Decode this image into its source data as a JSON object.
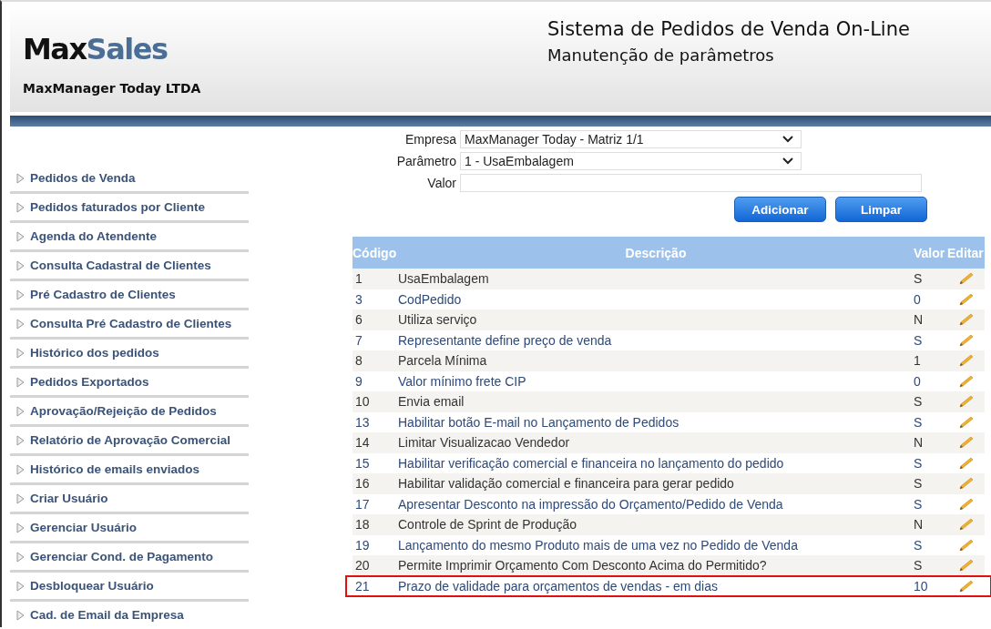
{
  "header": {
    "logo": {
      "part_1": "Max",
      "part_2": "Sales"
    },
    "company": "MaxManager Today LTDA",
    "title": "Sistema de Pedidos de Venda On-Line",
    "subtitle": "Manutenção de parâmetros"
  },
  "sidebar": {
    "items": [
      {
        "label": "Pedidos de Venda"
      },
      {
        "label": "Pedidos faturados por Cliente"
      },
      {
        "label": "Agenda do Atendente"
      },
      {
        "label": "Consulta Cadastral de Clientes"
      },
      {
        "label": "Pré Cadastro de Clientes"
      },
      {
        "label": "Consulta Pré Cadastro de Clientes"
      },
      {
        "label": "Histórico dos pedidos"
      },
      {
        "label": "Pedidos Exportados"
      },
      {
        "label": "Aprovação/Rejeição de Pedidos"
      },
      {
        "label": "Relatório de Aprovação Comercial"
      },
      {
        "label": "Histórico de emails enviados"
      },
      {
        "label": "Criar Usuário"
      },
      {
        "label": "Gerenciar Usuário"
      },
      {
        "label": "Gerenciar Cond. de Pagamento"
      },
      {
        "label": "Desbloquear Usuário"
      },
      {
        "label": "Cad. de Email da Empresa"
      }
    ]
  },
  "form": {
    "fields": [
      {
        "kind": "select",
        "label": "Empresa",
        "value": "MaxManager Today - Matriz 1/1"
      },
      {
        "kind": "select",
        "label": "Parâmetro",
        "value": "1 - UsaEmbalagem"
      },
      {
        "kind": "text",
        "label": "Valor"
      }
    ],
    "buttons": [
      "Adicionar",
      "Limpar"
    ]
  },
  "table": {
    "columns": [
      "Código",
      "Descrição",
      "Valor",
      "Editar"
    ],
    "rows": [
      {
        "code": "1",
        "description": "UsaEmbalagem",
        "value": "S",
        "highlighted": false
      },
      {
        "code": "3",
        "description": "CodPedido",
        "value": "0",
        "highlighted": false
      },
      {
        "code": "6",
        "description": "Utiliza serviço",
        "value": "N",
        "highlighted": false
      },
      {
        "code": "7",
        "description": "Representante define preço de venda",
        "value": "S",
        "highlighted": false
      },
      {
        "code": "8",
        "description": "Parcela Mínima",
        "value": "1",
        "highlighted": false
      },
      {
        "code": "9",
        "description": "Valor mínimo frete CIP",
        "value": "0",
        "highlighted": false
      },
      {
        "code": "10",
        "description": "Envia email",
        "value": "S",
        "highlighted": false
      },
      {
        "code": "13",
        "description": "Habilitar botão E-mail no Lançamento de Pedidos",
        "value": "S",
        "highlighted": false
      },
      {
        "code": "14",
        "description": "Limitar Visualizacao Vendedor",
        "value": "N",
        "highlighted": false
      },
      {
        "code": "15",
        "description": "Habilitar verificação comercial e financeira no lançamento do pedido",
        "value": "S",
        "highlighted": false
      },
      {
        "code": "16",
        "description": "Habilitar validação comercial e financeira para gerar pedido",
        "value": "S",
        "highlighted": false
      },
      {
        "code": "17",
        "description": "Apresentar Desconto na impressão do Orçamento/Pedido de Venda",
        "value": "S",
        "highlighted": false
      },
      {
        "code": "18",
        "description": "Controle de Sprint de Produção",
        "value": "N",
        "highlighted": false
      },
      {
        "code": "19",
        "description": "Lançamento do mesmo Produto mais de uma vez no Pedido de Venda",
        "value": "S",
        "highlighted": false
      },
      {
        "code": "20",
        "description": "Permite Imprimir Orçamento Com Desconto Acima do Permitido?",
        "value": "S",
        "highlighted": false
      },
      {
        "code": "21",
        "description": "Prazo de validade para orçamentos de vendas - em dias",
        "value": "10",
        "highlighted": true
      }
    ]
  }
}
